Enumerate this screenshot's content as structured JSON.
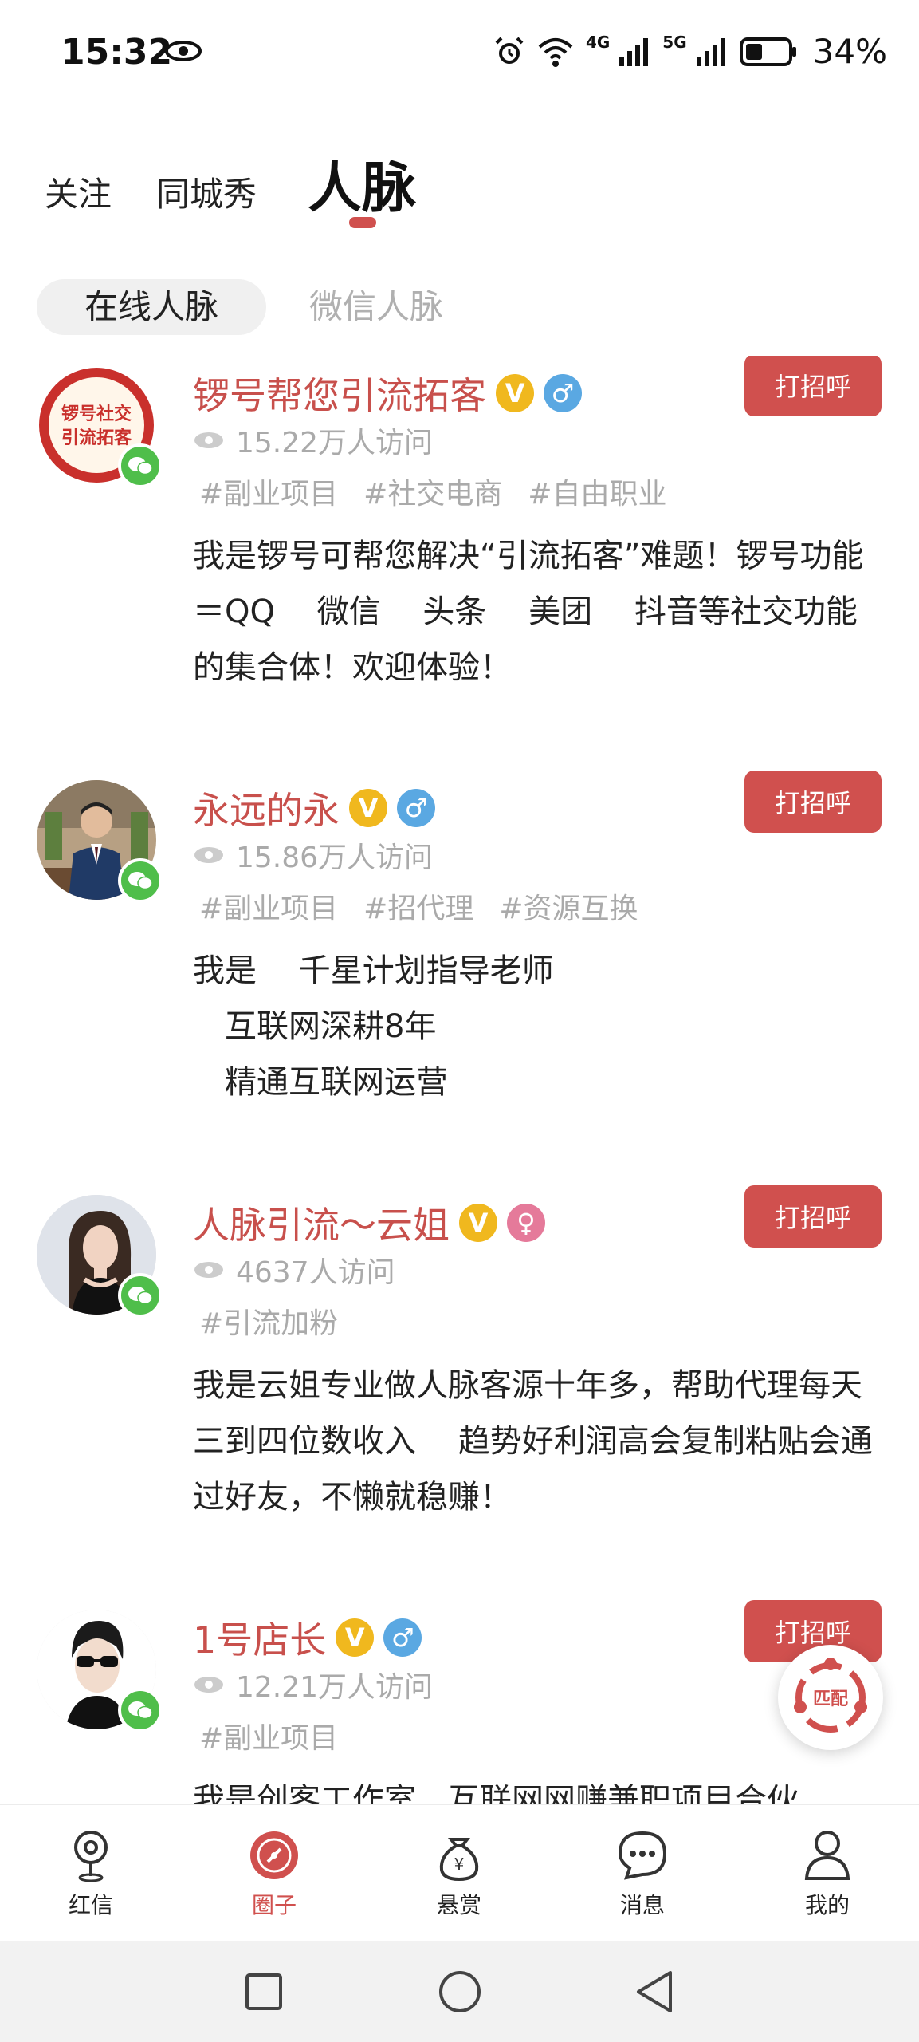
{
  "status_bar": {
    "time": "15:32",
    "network_1": "4G",
    "network_2": "5G",
    "battery": "34%"
  },
  "top_tabs": [
    {
      "label": "关注"
    },
    {
      "label": "同城秀"
    },
    {
      "label": "人脉"
    }
  ],
  "sub_tabs": [
    {
      "label": "在线人脉"
    },
    {
      "label": "微信人脉"
    }
  ],
  "greet_label": "打招呼",
  "contacts": [
    {
      "name": "锣号帮您引流拓客",
      "verified_badge": "V",
      "gender": "male",
      "visits": "15.22万人访问",
      "tags": [
        "#副业项目",
        "#社交电商",
        "#自由职业"
      ],
      "intro": "我是锣号可帮您解决“引流拓客”难题！锣号功能＝QQ　 微信　 头条　 美团　 抖音等社交功能的集合体！欢迎体验！",
      "avatar_text": "锣号社交\n引流拓客"
    },
    {
      "name": "永远的永",
      "verified_badge": "V",
      "gender": "male",
      "visits": "15.86万人访问",
      "tags": [
        "#副业项目",
        "#招代理",
        "#资源互换"
      ],
      "intro": "我是　 千星计划指导老师\n　互联网深耕8年\n　精通互联网运营"
    },
    {
      "name": "人脉引流～云姐",
      "verified_badge": "V",
      "gender": "female",
      "visits": "4637人访问",
      "tags": [
        "#引流加粉"
      ],
      "intro": "我是云姐专业做人脉客源十年多，帮助代理每天三到四位数收入　 趋势好利润高会复制粘贴会通过好友，不懒就稳赚！"
    },
    {
      "name": "1号店长",
      "verified_badge": "V",
      "gender": "male",
      "visits": "12.21万人访问",
      "tags": [
        "#副业项目"
      ],
      "intro": "我是创客工作室　互联网网赚兼职项目合伙"
    }
  ],
  "match_button": {
    "label": "匹配"
  },
  "bottom_nav": [
    {
      "label": "红信",
      "icon": "location-pin-icon"
    },
    {
      "label": "圈子",
      "icon": "compass-icon",
      "active": true
    },
    {
      "label": "悬赏",
      "icon": "money-bag-icon"
    },
    {
      "label": "消息",
      "icon": "chat-bubble-icon"
    },
    {
      "label": "我的",
      "icon": "person-icon"
    }
  ],
  "colors": {
    "accent": "#d0504e",
    "name": "#c8504c",
    "verified": "#f0b81e",
    "male": "#5aa8e2",
    "female": "#e57a9a",
    "wechat": "#4fbe4a"
  }
}
